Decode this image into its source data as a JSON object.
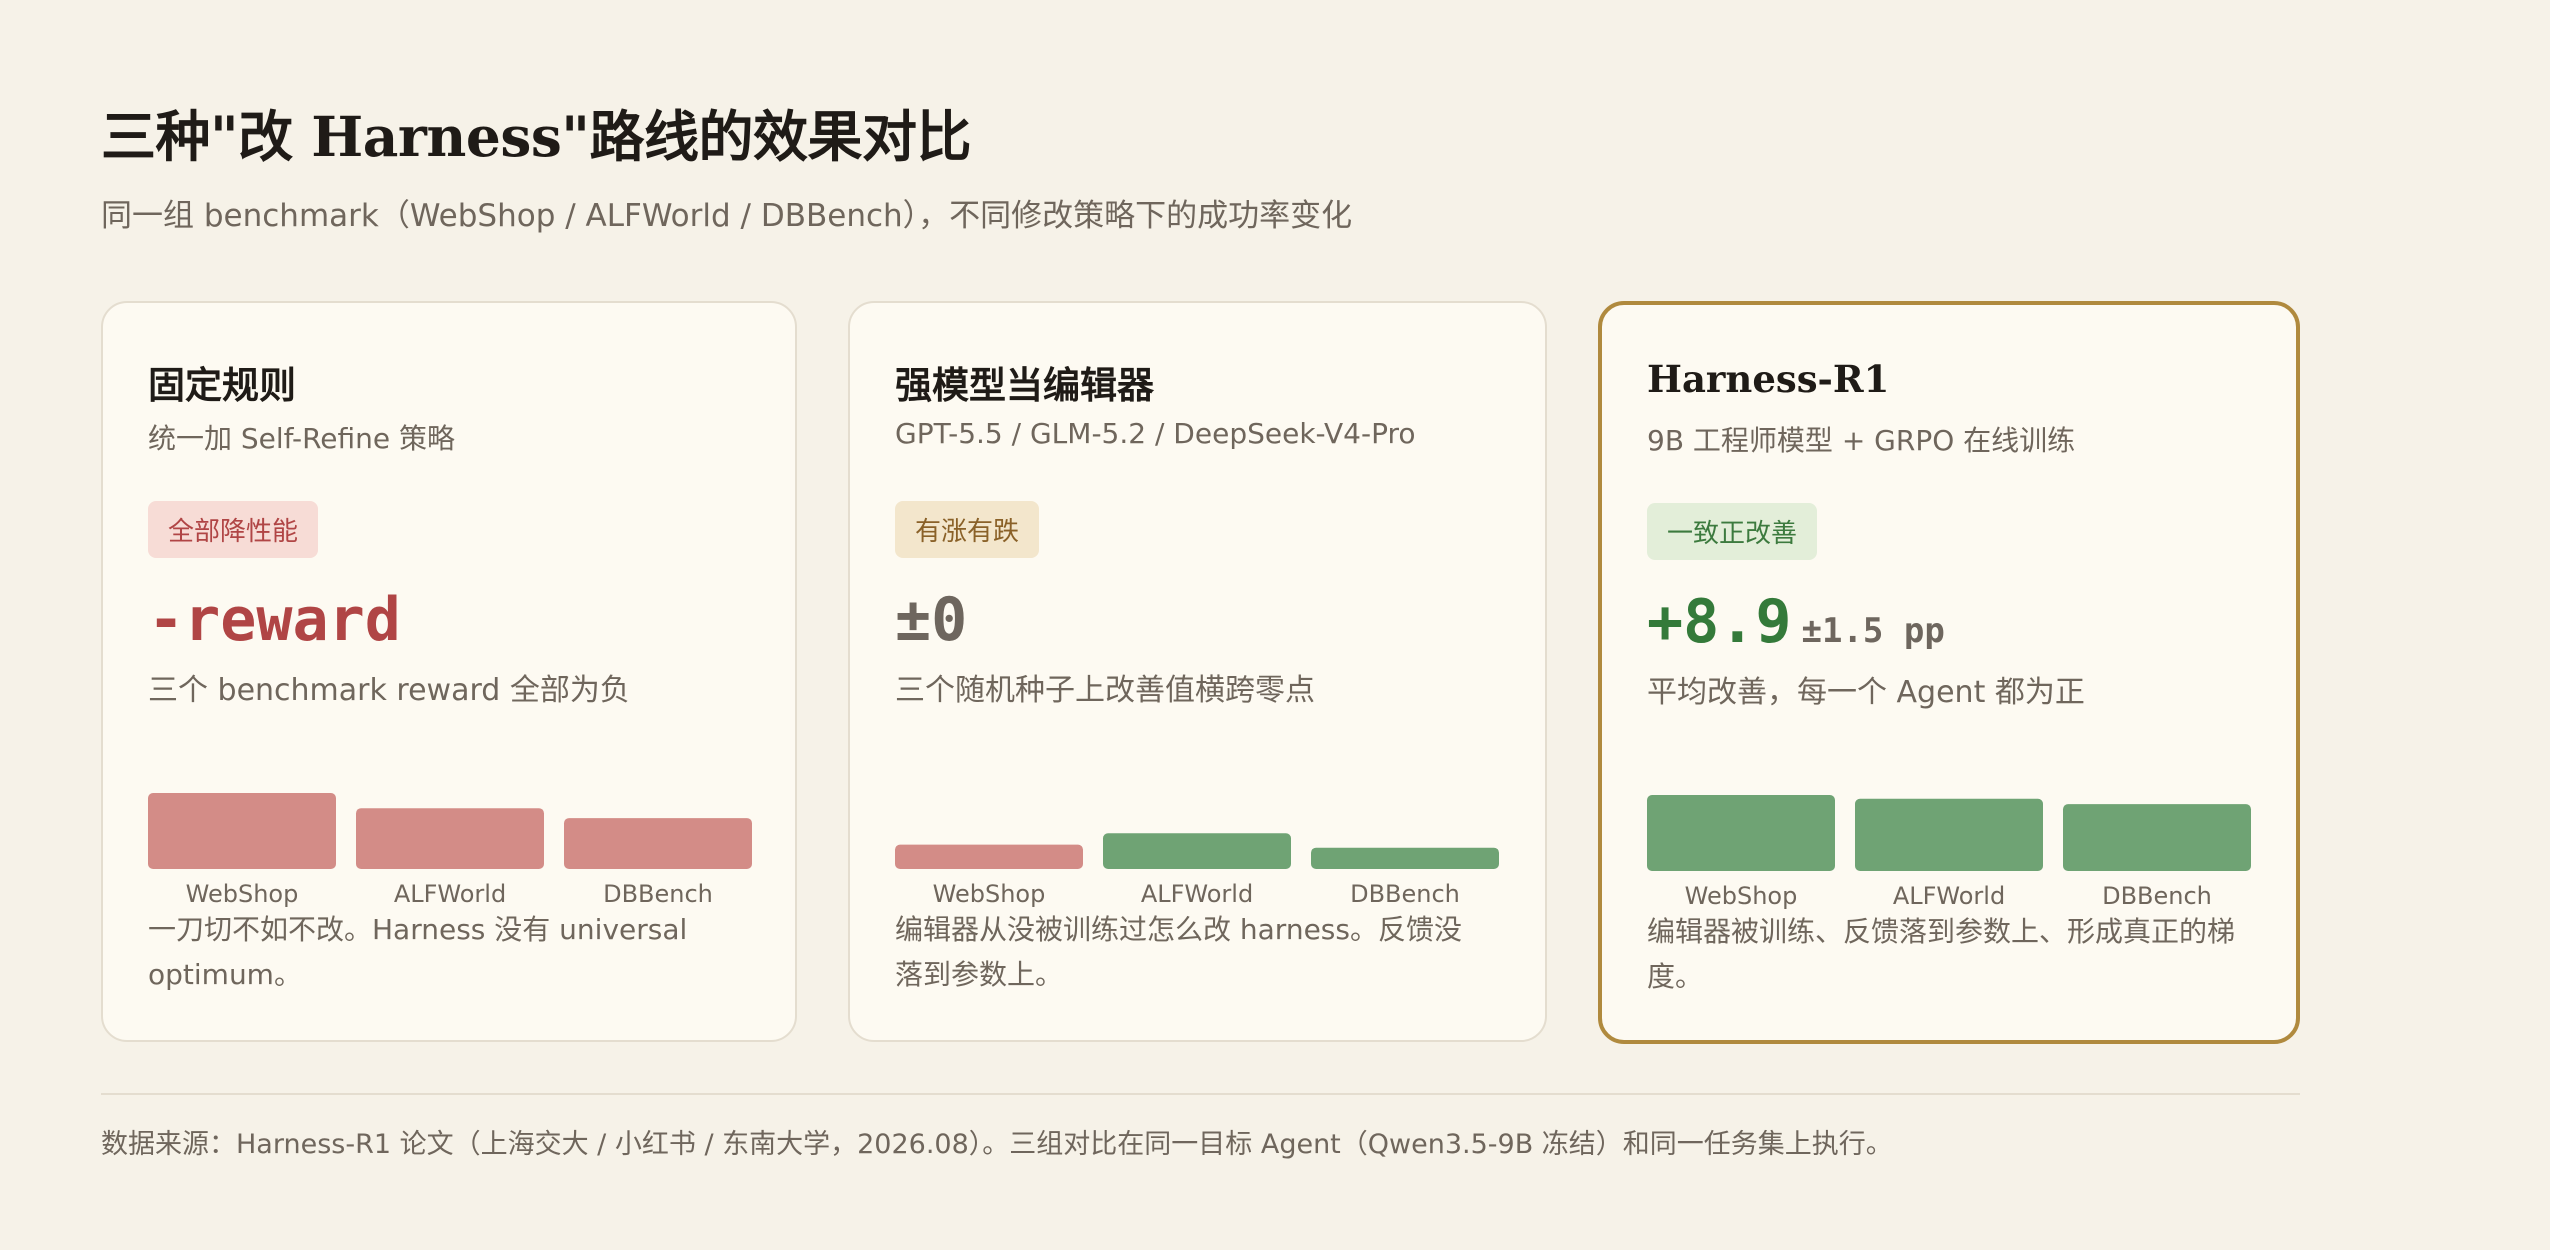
{
  "header": {
    "title": "三种\"改 Harness\"路线的效果对比",
    "subtitle": "同一组 benchmark（WebShop / ALFWorld / DBBench），不同修改策略下的成功率变化"
  },
  "cards": [
    {
      "title": "固定规则",
      "subtitle": "统一加 Self-Refine 策略",
      "badge": "全部降性能",
      "metric": "-reward",
      "metric_unit": "",
      "description": "三个 benchmark reward 全部为负",
      "note": "一刀切不如不改。Harness 没有 universal optimum。"
    },
    {
      "title": "强模型当编辑器",
      "subtitle": "GPT-5.5 / GLM-5.2 / DeepSeek-V4-Pro",
      "badge": "有涨有跌",
      "metric": "±0",
      "metric_unit": "",
      "description": "三个随机种子上改善值横跨零点",
      "note": "编辑器从没被训练过怎么改 harness。反馈没落到参数上。"
    },
    {
      "title": "Harness-R1",
      "subtitle": "9B 工程师模型 + GRPO 在线训练",
      "badge": "一致正改善",
      "metric": "+8.9",
      "metric_unit": "±1.5 pp",
      "description": "平均改善，每一个 Agent 都为正",
      "note": "编辑器被训练、反馈落到参数上、形成真正的梯度。"
    }
  ],
  "colors": {
    "negative": "#d38c87",
    "positive": "#6fa374",
    "accent_border": "#b08a3e"
  },
  "chart_data": [
    {
      "type": "bar",
      "categories": [
        "WebShop",
        "ALFWorld",
        "DBBench"
      ],
      "values": [
        -1.0,
        -0.8,
        -0.67
      ],
      "xlabel": "",
      "ylabel": ""
    },
    {
      "type": "bar",
      "categories": [
        "WebShop",
        "ALFWorld",
        "DBBench"
      ],
      "values": [
        -0.32,
        0.47,
        0.28
      ],
      "xlabel": "",
      "ylabel": ""
    },
    {
      "type": "bar",
      "categories": [
        "WebShop",
        "ALFWorld",
        "DBBench"
      ],
      "values": [
        1.0,
        0.95,
        0.88
      ],
      "xlabel": "",
      "ylabel": ""
    }
  ],
  "footer": {
    "source": "数据来源：Harness-R1 论文（上海交大 / 小红书 / 东南大学，2026.08）。三组对比在同一目标 Agent（Qwen3.5-9B 冻结）和同一任务集上执行。"
  }
}
